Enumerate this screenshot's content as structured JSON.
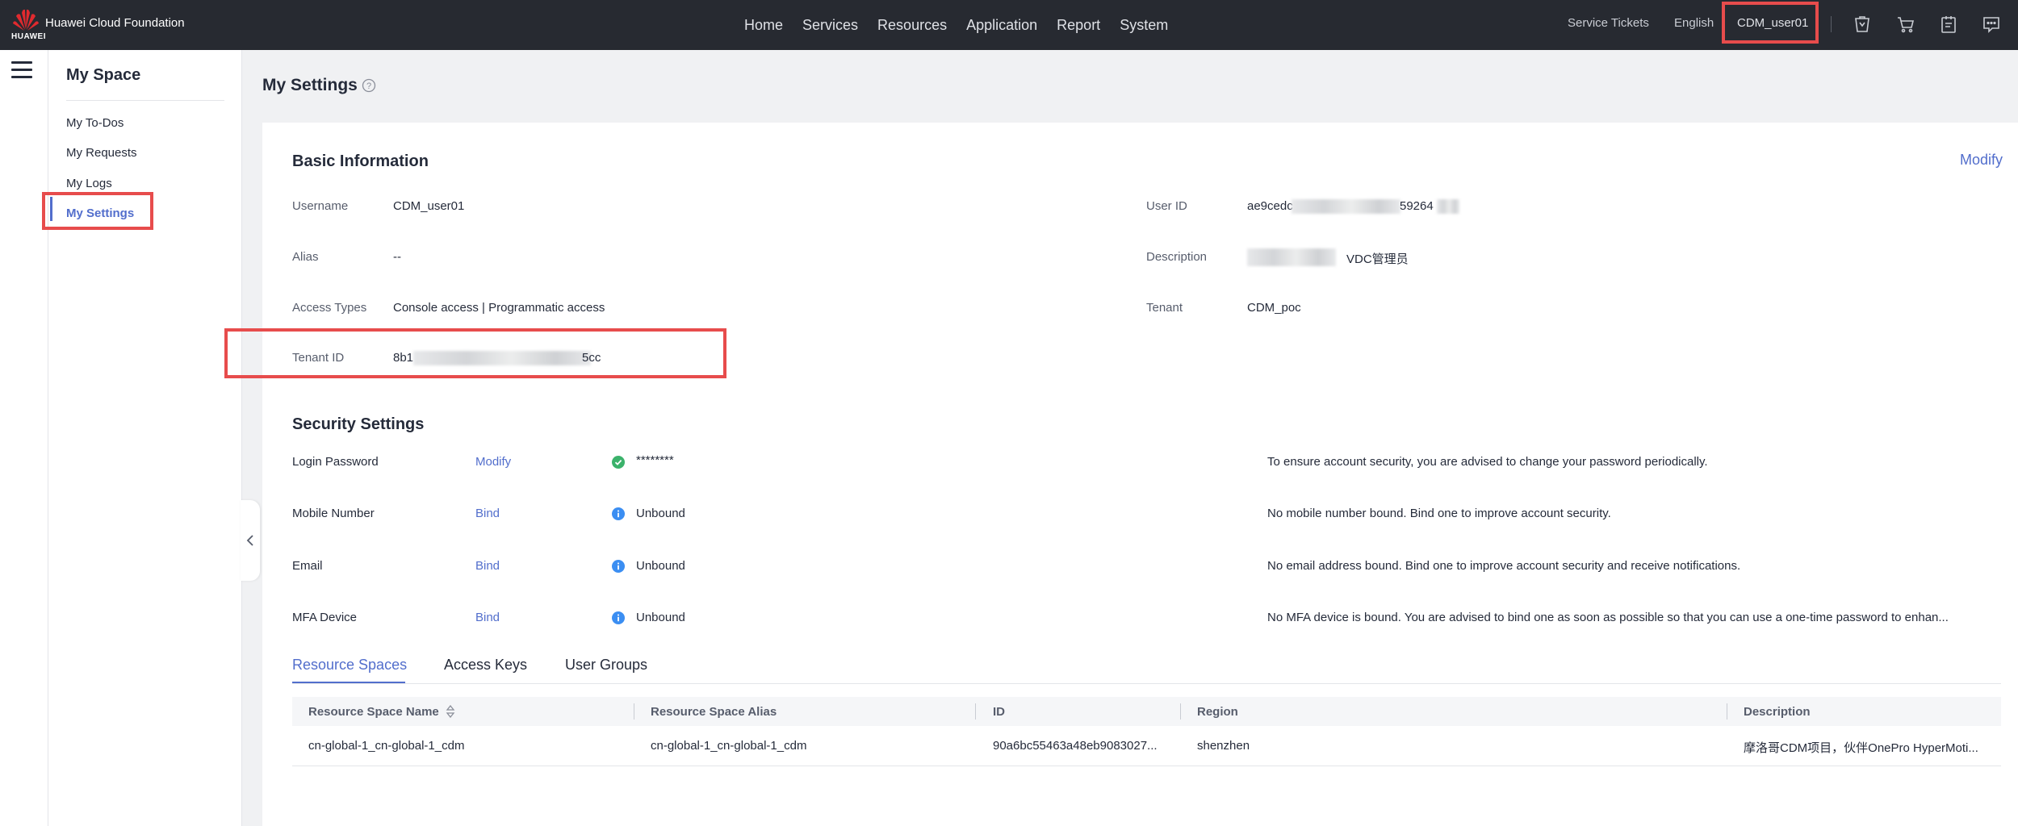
{
  "topbar": {
    "brand": "Huawei Cloud Foundation",
    "brand_sub": "HUAWEI",
    "nav": [
      "Home",
      "Services",
      "Resources",
      "Application",
      "Report",
      "System"
    ],
    "service_tickets": "Service Tickets",
    "language": "English",
    "username": "CDM_user01",
    "icons": [
      "recycle-bin-icon",
      "cart-icon",
      "clipboard-icon",
      "message-icon"
    ]
  },
  "sidebar": {
    "title": "My Space",
    "items": [
      {
        "label": "My To-Dos"
      },
      {
        "label": "My Requests"
      },
      {
        "label": "My Logs"
      },
      {
        "label": "My Settings",
        "active": true
      }
    ]
  },
  "page": {
    "title": "My Settings"
  },
  "basic": {
    "title": "Basic Information",
    "modify": "Modify",
    "username_label": "Username",
    "username_value": "CDM_user01",
    "alias_label": "Alias",
    "alias_value": "--",
    "access_label": "Access Types",
    "access_value": "Console access | Programmatic access",
    "tenant_id_label": "Tenant ID",
    "tenant_id_prefix": "8b1",
    "tenant_id_suffix": "5cc",
    "user_id_label": "User ID",
    "user_id_prefix": "ae9cedc",
    "user_id_mid": "59264",
    "description_label": "Description",
    "description_value": "VDC管理员",
    "tenant_label": "Tenant",
    "tenant_value": "CDM_poc"
  },
  "security": {
    "title": "Security Settings",
    "rows": [
      {
        "label": "Login Password",
        "action": "Modify",
        "status": "********",
        "status_type": "ok",
        "note": "To ensure account security, you are advised to change your password periodically."
      },
      {
        "label": "Mobile Number",
        "action": "Bind",
        "status": "Unbound",
        "status_type": "info",
        "note": "No mobile number bound. Bind one to improve account security."
      },
      {
        "label": "Email",
        "action": "Bind",
        "status": "Unbound",
        "status_type": "info",
        "note": "No email address bound. Bind one to improve account security and receive notifications."
      },
      {
        "label": "MFA Device",
        "action": "Bind",
        "status": "Unbound",
        "status_type": "info",
        "note": "No MFA device is bound. You are advised to bind one as soon as possible so that you can use a one-time password to enhan..."
      }
    ]
  },
  "tabs": [
    "Resource Spaces",
    "Access Keys",
    "User Groups"
  ],
  "table": {
    "columns": [
      "Resource Space Name",
      "Resource Space Alias",
      "ID",
      "Region",
      "Description"
    ],
    "rows": [
      [
        "cn-global-1_cn-global-1_cdm",
        "cn-global-1_cn-global-1_cdm",
        "90a6bc55463a48eb9083027...",
        "shenzhen",
        "摩洛哥CDM项目，伙伴OnePro HyperMoti..."
      ]
    ]
  },
  "colors": {
    "topbar_bg": "#272a31",
    "accent": "#526ecc",
    "highlight_box": "#e74c4c",
    "ok": "#3bb26b",
    "info": "#3b8ef2"
  }
}
